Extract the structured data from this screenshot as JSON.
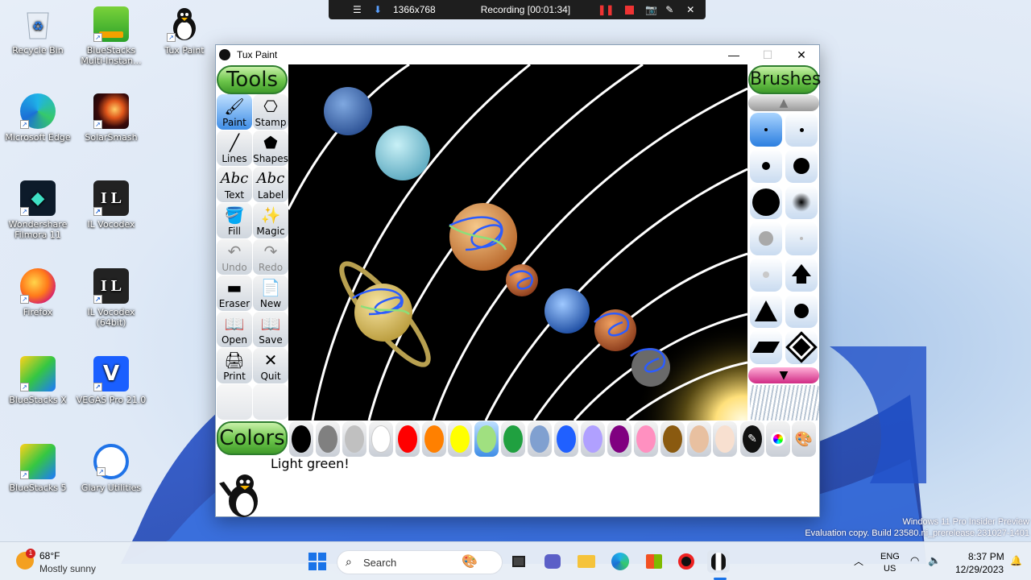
{
  "recording_bar": {
    "resolution": "1366x768",
    "status": "Recording [00:01:34]"
  },
  "desktop_icons": [
    {
      "label": "Recycle Bin"
    },
    {
      "label": "BlueStacks Multi-Instan..."
    },
    {
      "label": "Tux Paint"
    },
    {
      "label": "Microsoft Edge"
    },
    {
      "label": "SolarSmash"
    },
    {
      "label": "Wondershare Filmora 11"
    },
    {
      "label": "IL Vocodex"
    },
    {
      "label": "Firefox"
    },
    {
      "label": "IL Vocodex (64bit)"
    },
    {
      "label": "BlueStacks X"
    },
    {
      "label": "VEGAS Pro 21.0"
    },
    {
      "label": "BlueStacks 5"
    },
    {
      "label": "Glary Utilities"
    }
  ],
  "window": {
    "title": "Tux Paint",
    "tools_header": "Tools",
    "brushes_header": "Brushes",
    "colors_header": "Colors",
    "tools": [
      {
        "label": "Paint",
        "icon": "paintbrush-icon",
        "selected": true
      },
      {
        "label": "Stamp",
        "icon": "stamp-icon"
      },
      {
        "label": "Lines",
        "icon": "lines-icon"
      },
      {
        "label": "Shapes",
        "icon": "pentagon-icon"
      },
      {
        "label": "Text",
        "icon": "text-icon",
        "glyph": "Abc"
      },
      {
        "label": "Label",
        "icon": "label-icon",
        "glyph": "Abc"
      },
      {
        "label": "Fill",
        "icon": "fill-bucket-icon"
      },
      {
        "label": "Magic",
        "icon": "magic-wand-icon"
      },
      {
        "label": "Undo",
        "icon": "undo-icon",
        "disabled": true
      },
      {
        "label": "Redo",
        "icon": "redo-icon",
        "disabled": true
      },
      {
        "label": "Eraser",
        "icon": "eraser-icon"
      },
      {
        "label": "New",
        "icon": "new-page-icon"
      },
      {
        "label": "Open",
        "icon": "open-book-icon"
      },
      {
        "label": "Save",
        "icon": "save-book-icon"
      },
      {
        "label": "Print",
        "icon": "printer-icon"
      },
      {
        "label": "Quit",
        "icon": "quit-icon"
      }
    ],
    "colors": [
      "#000000",
      "#808080",
      "#c0c0c0",
      "#ffffff",
      "#ff0000",
      "#ff8000",
      "#ffff00",
      "#a0e080",
      "#20a040",
      "#80a0d0",
      "#2060ff",
      "#b0a0ff",
      "#800080",
      "#ff90c0",
      "#8a5a10",
      "#e8c0a0",
      "#f8e0d0"
    ],
    "selected_color_index": 7,
    "status_message": "Light green!"
  },
  "taskbar": {
    "weather_temp": "68°F",
    "weather_desc": "Mostly sunny",
    "weather_badge": "1",
    "search_label": "Search",
    "lang_line1": "ENG",
    "lang_line2": "US",
    "time": "8:37 PM",
    "date": "12/29/2023"
  },
  "watermark": {
    "line1": "Windows 11 Pro Insider Preview",
    "line2": "Evaluation copy. Build 23580.ni_prerelease.231027-1401"
  }
}
